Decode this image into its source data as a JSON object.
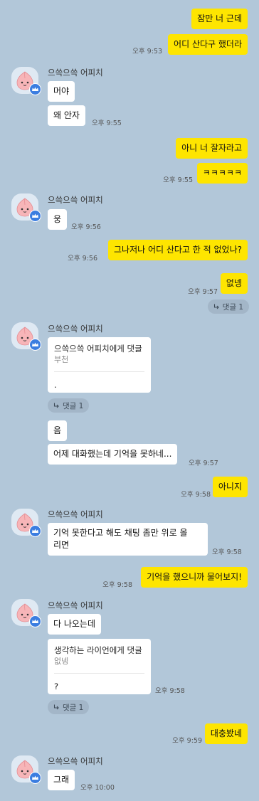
{
  "sender_name": "으쓱으쓱 어피치",
  "comment_label": "댓글 1",
  "messages": [
    {
      "text": "잠만 너 근데"
    },
    {
      "text": "어디 산다구 했더라",
      "time": "오후 9:53"
    },
    {
      "text": "머야"
    },
    {
      "text": "왜 안자",
      "time": "오후 9:55"
    },
    {
      "text": "아니 너 잘자라고"
    },
    {
      "text": "ㅋㅋㅋㅋㅋ",
      "time": "오후 9:55"
    },
    {
      "text": "웅",
      "time": "오후 9:56"
    },
    {
      "text": "그나저나 어디 산다고 한 적 없었나?",
      "time": "오후 9:56"
    },
    {
      "text": "없넹",
      "time": "오후 9:57"
    },
    {
      "text": "음"
    },
    {
      "text": "어제 대화했는데 기억을 못하네...",
      "time": "오후 9:57"
    },
    {
      "text": "아니지",
      "time": "오후 9:58"
    },
    {
      "text": "기억 못한다고 해도 채팅 좀만 위로 올",
      "text2": "리면",
      "time": "오후 9:58"
    },
    {
      "text": "기억을 했으니까 물어보지!",
      "time": "오후 9:58"
    },
    {
      "text": "다 나오는데"
    },
    {
      "text": "대충봤네",
      "time": "오후 9:59"
    },
    {
      "text": "그래",
      "time": "오후 10:00"
    }
  ],
  "replies": [
    {
      "title": "으쓱으쓱 어피치에게 댓글",
      "quote": "부천",
      "text": "."
    },
    {
      "title": "생각하는 라이언에게 댓글",
      "quote": "없넹",
      "text": "?",
      "time": "오후 9:58"
    }
  ],
  "colors": {
    "background": "#b2c7d9",
    "my_bubble": "#fee500",
    "their_bubble": "#ffffff",
    "badge": "#3b7de0"
  }
}
